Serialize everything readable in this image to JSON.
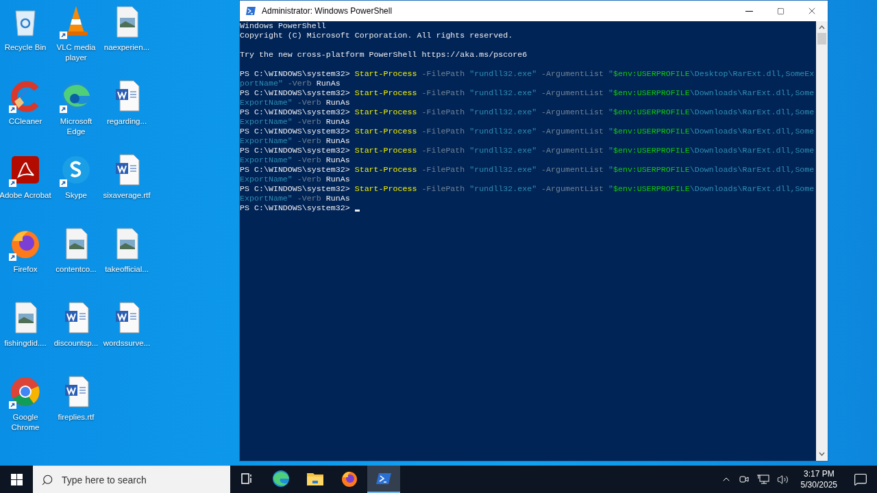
{
  "desktop_icons": [
    {
      "label": "Recycle Bin",
      "kind": "recycle",
      "shortcut": false
    },
    {
      "label": "VLC media player",
      "kind": "vlc",
      "shortcut": true
    },
    {
      "label": "naexperien...",
      "kind": "image",
      "shortcut": false
    },
    {
      "label": "CCleaner",
      "kind": "ccleaner",
      "shortcut": true
    },
    {
      "label": "Microsoft Edge",
      "kind": "edge",
      "shortcut": true
    },
    {
      "label": "regarding...",
      "kind": "word",
      "shortcut": false
    },
    {
      "label": "Adobe Acrobat",
      "kind": "acrobat",
      "shortcut": true
    },
    {
      "label": "Skype",
      "kind": "skype",
      "shortcut": true
    },
    {
      "label": "sixaverage.rtf",
      "kind": "word",
      "shortcut": false
    },
    {
      "label": "Firefox",
      "kind": "firefox",
      "shortcut": true
    },
    {
      "label": "contentco...",
      "kind": "image",
      "shortcut": false
    },
    {
      "label": "takeofficial...",
      "kind": "image",
      "shortcut": false
    },
    {
      "label": "fishingdid....",
      "kind": "image",
      "shortcut": false
    },
    {
      "label": "discountsp...",
      "kind": "word",
      "shortcut": false
    },
    {
      "label": "wordssurve...",
      "kind": "word",
      "shortcut": false
    },
    {
      "label": "Google Chrome",
      "kind": "chrome",
      "shortcut": true
    },
    {
      "label": "fireplies.rtf",
      "kind": "word",
      "shortcut": false
    }
  ],
  "window": {
    "title": "Administrator: Windows PowerShell",
    "lines": [
      {
        "kind": "text",
        "segments": [
          {
            "kind": "plain",
            "text": "Windows PowerShell"
          }
        ]
      },
      {
        "kind": "text",
        "segments": [
          {
            "kind": "plain",
            "text": "Copyright (C) Microsoft Corporation. All rights reserved."
          }
        ]
      },
      {
        "kind": "blank"
      },
      {
        "kind": "text",
        "segments": [
          {
            "kind": "plain",
            "text": "Try the new cross-platform PowerShell https://aka.ms/pscore6"
          }
        ]
      },
      {
        "kind": "blank"
      },
      {
        "kind": "text",
        "segments": [
          {
            "kind": "plain",
            "text": "PS C:\\WINDOWS\\system32> "
          },
          {
            "kind": "cmdlet",
            "text": "Start-Process"
          },
          {
            "kind": "param",
            "text": " -FilePath"
          },
          {
            "kind": "string",
            "text": " \"rundll32.exe\""
          },
          {
            "kind": "param",
            "text": " -ArgumentList"
          },
          {
            "kind": "string",
            "text": " \""
          },
          {
            "kind": "variable",
            "text": "$env:USERPROFILE"
          },
          {
            "kind": "string",
            "text": "\\Desktop\\RarExt.dll,SomeEx"
          }
        ]
      },
      {
        "kind": "text",
        "segments": [
          {
            "kind": "string",
            "text": "portName\""
          },
          {
            "kind": "param",
            "text": " -Verb"
          },
          {
            "kind": "plain",
            "text": " RunAs"
          }
        ]
      },
      {
        "kind": "text",
        "segments": [
          {
            "kind": "plain",
            "text": "PS C:\\WINDOWS\\system32> "
          },
          {
            "kind": "cmdlet",
            "text": "Start-Process"
          },
          {
            "kind": "param",
            "text": " -FilePath"
          },
          {
            "kind": "string",
            "text": " \"rundll32.exe\""
          },
          {
            "kind": "param",
            "text": " -ArgumentList"
          },
          {
            "kind": "string",
            "text": " \""
          },
          {
            "kind": "variable",
            "text": "$env:USERPROFILE"
          },
          {
            "kind": "string",
            "text": "\\Downloads\\RarExt.dll,Some"
          }
        ]
      },
      {
        "kind": "text",
        "segments": [
          {
            "kind": "string",
            "text": "ExportName\""
          },
          {
            "kind": "param",
            "text": " -Verb"
          },
          {
            "kind": "plain",
            "text": " RunAs"
          }
        ]
      },
      {
        "kind": "text",
        "segments": [
          {
            "kind": "plain",
            "text": "PS C:\\WINDOWS\\system32> "
          },
          {
            "kind": "cmdlet",
            "text": "Start-Process"
          },
          {
            "kind": "param",
            "text": " -FilePath"
          },
          {
            "kind": "string",
            "text": " \"rundll32.exe\""
          },
          {
            "kind": "param",
            "text": " -ArgumentList"
          },
          {
            "kind": "string",
            "text": " \""
          },
          {
            "kind": "variable",
            "text": "$env:USERPROFILE"
          },
          {
            "kind": "string",
            "text": "\\Downloads\\RarExt.dll,Some"
          }
        ]
      },
      {
        "kind": "text",
        "segments": [
          {
            "kind": "string",
            "text": "ExportName\""
          },
          {
            "kind": "param",
            "text": " -Verb"
          },
          {
            "kind": "plain",
            "text": " RunAs"
          }
        ]
      },
      {
        "kind": "text",
        "segments": [
          {
            "kind": "plain",
            "text": "PS C:\\WINDOWS\\system32> "
          },
          {
            "kind": "cmdlet",
            "text": "Start-Process"
          },
          {
            "kind": "param",
            "text": " -FilePath"
          },
          {
            "kind": "string",
            "text": " \"rundll32.exe\""
          },
          {
            "kind": "param",
            "text": " -ArgumentList"
          },
          {
            "kind": "string",
            "text": " \""
          },
          {
            "kind": "variable",
            "text": "$env:USERPROFILE"
          },
          {
            "kind": "string",
            "text": "\\Downloads\\RarExt.dll,Some"
          }
        ]
      },
      {
        "kind": "text",
        "segments": [
          {
            "kind": "string",
            "text": "ExportName\""
          },
          {
            "kind": "param",
            "text": " -Verb"
          },
          {
            "kind": "plain",
            "text": " RunAs"
          }
        ]
      },
      {
        "kind": "text",
        "segments": [
          {
            "kind": "plain",
            "text": "PS C:\\WINDOWS\\system32> "
          },
          {
            "kind": "cmdlet",
            "text": "Start-Process"
          },
          {
            "kind": "param",
            "text": " -FilePath"
          },
          {
            "kind": "string",
            "text": " \"rundll32.exe\""
          },
          {
            "kind": "param",
            "text": " -ArgumentList"
          },
          {
            "kind": "string",
            "text": " \""
          },
          {
            "kind": "variable",
            "text": "$env:USERPROFILE"
          },
          {
            "kind": "string",
            "text": "\\Downloads\\RarExt.dll,Some"
          }
        ]
      },
      {
        "kind": "text",
        "segments": [
          {
            "kind": "string",
            "text": "ExportName\""
          },
          {
            "kind": "param",
            "text": " -Verb"
          },
          {
            "kind": "plain",
            "text": " RunAs"
          }
        ]
      },
      {
        "kind": "text",
        "segments": [
          {
            "kind": "plain",
            "text": "PS C:\\WINDOWS\\system32> "
          },
          {
            "kind": "cmdlet",
            "text": "Start-Process"
          },
          {
            "kind": "param",
            "text": " -FilePath"
          },
          {
            "kind": "string",
            "text": " \"rundll32.exe\""
          },
          {
            "kind": "param",
            "text": " -ArgumentList"
          },
          {
            "kind": "string",
            "text": " \""
          },
          {
            "kind": "variable",
            "text": "$env:USERPROFILE"
          },
          {
            "kind": "string",
            "text": "\\Downloads\\RarExt.dll,Some"
          }
        ]
      },
      {
        "kind": "text",
        "segments": [
          {
            "kind": "string",
            "text": "ExportName\""
          },
          {
            "kind": "param",
            "text": " -Verb"
          },
          {
            "kind": "plain",
            "text": " RunAs"
          }
        ]
      },
      {
        "kind": "text",
        "segments": [
          {
            "kind": "plain",
            "text": "PS C:\\WINDOWS\\system32> "
          },
          {
            "kind": "cmdlet",
            "text": "Start-Process"
          },
          {
            "kind": "param",
            "text": " -FilePath"
          },
          {
            "kind": "string",
            "text": " \"rundll32.exe\""
          },
          {
            "kind": "param",
            "text": " -ArgumentList"
          },
          {
            "kind": "string",
            "text": " \""
          },
          {
            "kind": "variable",
            "text": "$env:USERPROFILE"
          },
          {
            "kind": "string",
            "text": "\\Downloads\\RarExt.dll,Some"
          }
        ]
      },
      {
        "kind": "text",
        "segments": [
          {
            "kind": "string",
            "text": "ExportName\""
          },
          {
            "kind": "param",
            "text": " -Verb"
          },
          {
            "kind": "plain",
            "text": " RunAs"
          }
        ]
      },
      {
        "kind": "prompt",
        "segments": [
          {
            "kind": "plain",
            "text": "PS C:\\WINDOWS\\system32> "
          }
        ]
      }
    ]
  },
  "taskbar": {
    "search": {
      "placeholder": "Type here to search"
    },
    "apps": [
      {
        "kind": "taskview",
        "active": false
      },
      {
        "kind": "edge",
        "active": false
      },
      {
        "kind": "explorer",
        "active": false
      },
      {
        "kind": "firefox",
        "active": false
      },
      {
        "kind": "powershell",
        "active": true
      }
    ],
    "clock": {
      "time": "3:17 PM",
      "date": "5/30/2025"
    }
  }
}
